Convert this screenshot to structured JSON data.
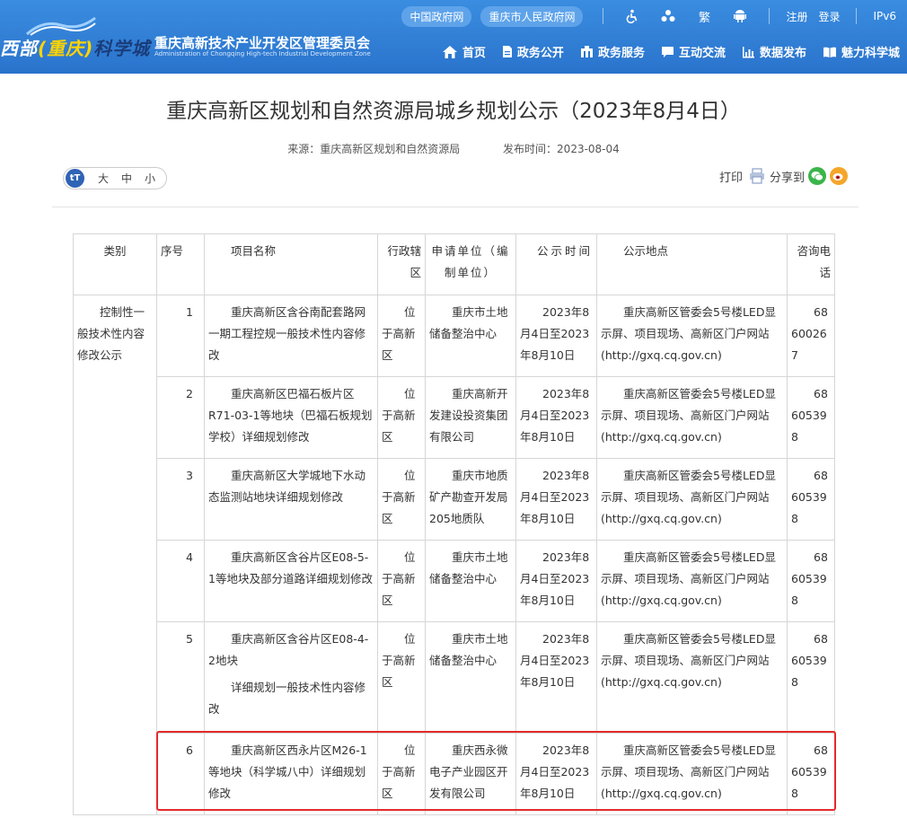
{
  "header": {
    "logo_text": "西部(重庆)科学城",
    "logo_part1": "西部",
    "logo_part2": "(重庆)",
    "logo_part3": "科学城",
    "org_name_cn": "重庆高新技术产业开发区管理委员会",
    "org_name_en": "Administration of Chongqing High-tech Industrial Development Zone",
    "top_links": {
      "gov_cn": "中国政府网",
      "cq_gov": "重庆市人民政府网",
      "traditional": "繁",
      "register": "注册",
      "login": "登录",
      "ipv6": "IPv6"
    },
    "nav": [
      "首页",
      "政务公开",
      "政务服务",
      "互动交流",
      "数据发布",
      "魅力科学城"
    ]
  },
  "article": {
    "title": "重庆高新区规划和自然资源局城乡规划公示（2023年8月4日）",
    "source": "来源：重庆高新区规划和自然资源局",
    "publish_time": "发布时间：2023-08-04",
    "font_size": {
      "icon": "tT",
      "large": "大",
      "medium": "中",
      "small": "小"
    },
    "print_label": "打印",
    "share_label": "分享到"
  },
  "table": {
    "headers": [
      "类别",
      "序号",
      "项目名称",
      "行政辖区",
      "申请单位（编制单位）",
      "公示时间",
      "公示地点",
      "咨询电话"
    ],
    "category": "控制性一般技术性内容修改公示",
    "rows": [
      {
        "no": "1",
        "name": "重庆高新区含谷南配套路网一期工程控规一般技术性内容修改",
        "district": "位于高新区",
        "unit": "重庆市土地储备整治中心",
        "time": "2023年8月4日至2023年8月10日",
        "place": "重庆高新区管委会5号楼LED显示屏、项目现场、高新区门户网站(http://gxq.cq.gov.cn)",
        "phone": "68600267"
      },
      {
        "no": "2",
        "name": "重庆高新区巴福石板片区R71-03-1等地块（巴福石板规划学校）详细规划修改",
        "district": "位于高新区",
        "unit": "重庆高新开发建设投资集团有限公司",
        "time": "2023年8月4日至2023年8月10日",
        "place": "重庆高新区管委会5号楼LED显示屏、项目现场、高新区门户网站(http://gxq.cq.gov.cn)",
        "phone": "68605398"
      },
      {
        "no": "3",
        "name": "重庆高新区大学城地下水动态监测站地块详细规划修改",
        "district": "位于高新区",
        "unit": "重庆市地质矿产勘查开发局205地质队",
        "time": "2023年8月4日至2023年8月10日",
        "place": "重庆高新区管委会5号楼LED显示屏、项目现场、高新区门户网站(http://gxq.cq.gov.cn)",
        "phone": "68605398"
      },
      {
        "no": "4",
        "name": "重庆高新区含谷片区E08-5-1等地块及部分道路详细规划修改",
        "district": "位于高新区",
        "unit": "重庆市土地储备整治中心",
        "time": "2023年8月4日至2023年8月10日",
        "place": "重庆高新区管委会5号楼LED显示屏、项目现场、高新区门户网站(http://gxq.cq.gov.cn)",
        "phone": "68605398"
      },
      {
        "no": "5",
        "name": "重庆高新区含谷片区E08-4-2地块",
        "name2": "详细规划一般技术性内容修改",
        "district": "位于高新区",
        "unit": "重庆市土地储备整治中心",
        "time": "2023年8月4日至2023年8月10日",
        "place": "重庆高新区管委会5号楼LED显示屏、项目现场、高新区门户网站(http://gxq.cq.gov.cn)",
        "phone": "68605398"
      },
      {
        "no": "6",
        "name": "重庆高新区西永片区M26-1等地块（科学城八中）详细规划修改",
        "district": "位于高新区",
        "unit": "重庆西永微电子产业园区开发有限公司",
        "time": "2023年8月4日至2023年8月10日",
        "place": "重庆高新区管委会5号楼LED显示屏、项目现场、高新区门户网站(http://gxq.cq.gov.cn)",
        "phone": "68605398"
      }
    ]
  },
  "colors": {
    "header_blue": "#2a73cc",
    "highlight_red": "#e32b2b",
    "logo_yellow": "#ffd400"
  }
}
